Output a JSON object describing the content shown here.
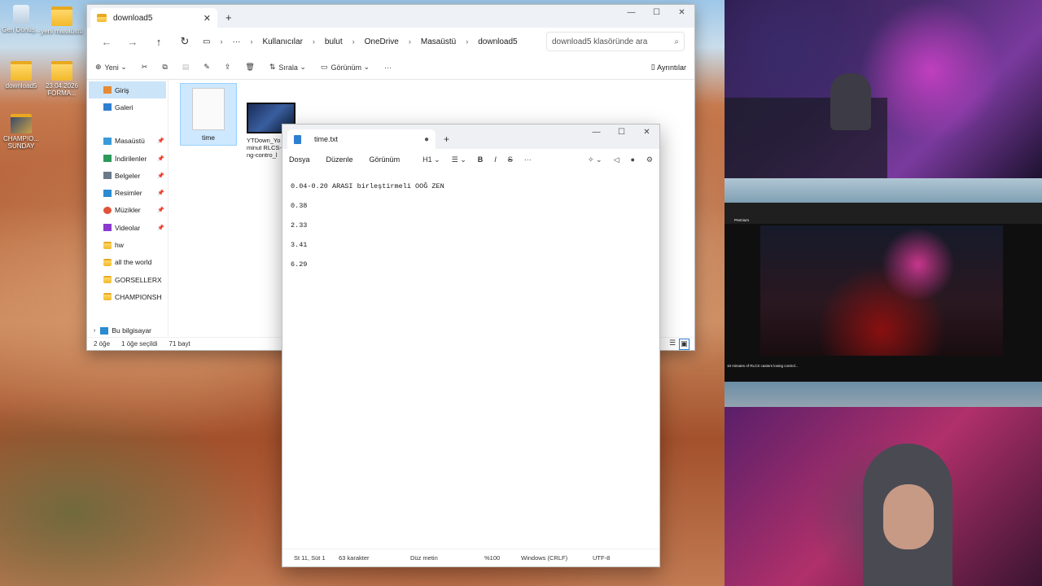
{
  "desktop": {
    "icons": [
      {
        "label": "Geri Dönüş..."
      },
      {
        "label": "yeni masaüstü"
      },
      {
        "label": "download5"
      },
      {
        "label": "23.04.2026 FORMA..."
      },
      {
        "label": "CHAMPIO... SUNDAY"
      }
    ]
  },
  "explorer": {
    "tab_title": "download5",
    "breadcrumbs": [
      "Kullanıcılar",
      "bulut",
      "OneDrive",
      "Masaüstü",
      "download5"
    ],
    "search_placeholder": "download5 klasöründe ara",
    "toolbar": {
      "new": "Yeni",
      "sort": "Sırala",
      "view": "Görünüm",
      "details": "Ayrıntılar"
    },
    "sidebar": [
      {
        "label": "Giriş"
      },
      {
        "label": "Galeri"
      },
      {
        "label": "Masaüstü"
      },
      {
        "label": "İndirilenler"
      },
      {
        "label": "Belgeler"
      },
      {
        "label": "Resimler"
      },
      {
        "label": "Müzikler"
      },
      {
        "label": "Videolar"
      },
      {
        "label": "hw"
      },
      {
        "label": "all the world"
      },
      {
        "label": "GORSELLERX"
      },
      {
        "label": "CHAMPIONSH"
      },
      {
        "label": "Bu bilgisayar"
      }
    ],
    "files": [
      {
        "name": "time"
      },
      {
        "name": "YTDown_Yo e_10-minut RLCS-caste ng-contro_l"
      }
    ],
    "status": {
      "count": "2 öğe",
      "selected": "1 öğe seçildi",
      "size": "71 bayt"
    }
  },
  "notepad": {
    "tab_title": "time.txt",
    "menu": [
      "Dosya",
      "Düzenle",
      "Görünüm"
    ],
    "heading_btn": "H1",
    "lines": [
      "0.04-0.20 ARASI birleştirmeli OOĞ ZEN",
      "0.38",
      "2.33",
      "3.41",
      "6.29"
    ],
    "status": {
      "position": "St 11, Süt 1",
      "chars": "63 karakter",
      "mode": "Düz metin",
      "zoom": "%100",
      "eol": "Windows (CRLF)",
      "encoding": "UTF-8"
    }
  },
  "stream": {
    "browser_brand": "Premium",
    "video_title": "10 minutes of RLCS casters losing control..."
  }
}
